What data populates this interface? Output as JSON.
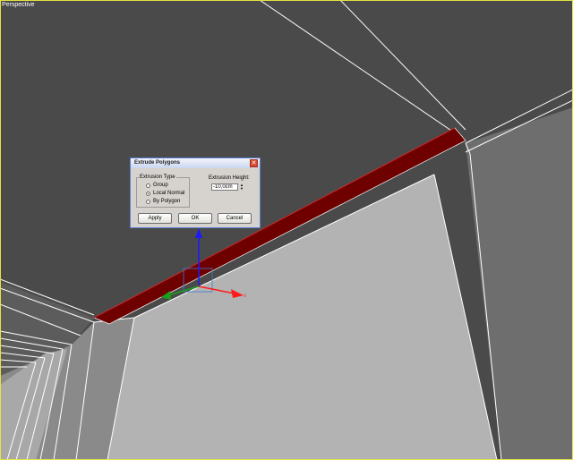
{
  "viewport": {
    "label": "Perspective",
    "colors": {
      "border": "#e3e345",
      "wire": "#ffffff",
      "ceiling": "#4a4a4a",
      "wall_left": "#b3b3b3",
      "wall_right": "#6e6e6e",
      "extrusion": "#6e0000",
      "gizmo_x": "#ff1a1a",
      "gizmo_y": "#1aa01a",
      "gizmo_z": "#1a1aff"
    }
  },
  "gizmo": {
    "x_label": "x",
    "icons": [
      "move-gizmo-icon"
    ]
  },
  "dialog": {
    "title": "Extrude Polygons",
    "extrusion_type": {
      "legend": "Extrusion Type",
      "options": [
        "Group",
        "Local Normal",
        "By Polygon"
      ],
      "selected": "Local Normal"
    },
    "extrusion_height": {
      "label": "Extrusion Height:",
      "value": "-10,0cm"
    },
    "buttons": {
      "apply": "Apply",
      "ok": "OK",
      "cancel": "Cancel"
    },
    "icons": [
      "close-icon",
      "spinner-up-icon",
      "spinner-down-icon"
    ]
  }
}
